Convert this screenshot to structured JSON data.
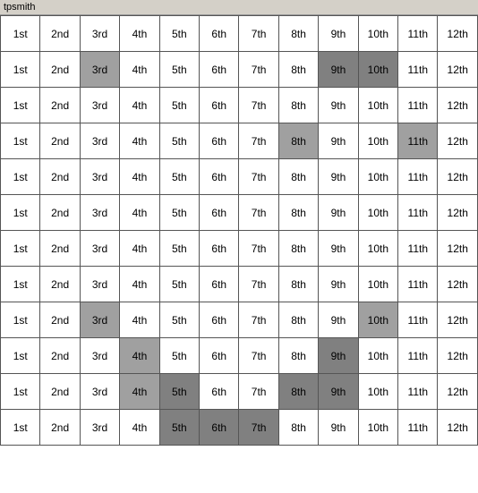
{
  "title": "tpsmith",
  "cols": [
    "1st",
    "2nd",
    "3rd",
    "4th",
    "5th",
    "6th",
    "7th",
    "8th",
    "9th",
    "10th",
    "11th",
    "12th"
  ],
  "rows": [
    [
      false,
      false,
      false,
      false,
      false,
      false,
      false,
      false,
      false,
      false,
      false,
      false
    ],
    [
      false,
      false,
      "gray",
      false,
      false,
      false,
      false,
      false,
      "dark",
      "dark",
      false,
      false
    ],
    [
      false,
      false,
      false,
      false,
      false,
      false,
      false,
      false,
      false,
      false,
      false,
      false
    ],
    [
      false,
      false,
      false,
      false,
      false,
      false,
      false,
      "gray",
      false,
      false,
      "gray",
      false
    ],
    [
      false,
      false,
      false,
      false,
      false,
      false,
      false,
      false,
      false,
      false,
      false,
      false
    ],
    [
      false,
      false,
      false,
      false,
      false,
      false,
      false,
      false,
      false,
      false,
      false,
      false
    ],
    [
      false,
      false,
      false,
      false,
      false,
      false,
      false,
      false,
      false,
      false,
      false,
      false
    ],
    [
      false,
      false,
      false,
      false,
      false,
      false,
      false,
      false,
      false,
      false,
      false,
      false
    ],
    [
      false,
      false,
      "gray",
      false,
      false,
      false,
      false,
      false,
      false,
      "gray",
      false,
      false
    ],
    [
      false,
      false,
      false,
      "gray",
      false,
      false,
      false,
      false,
      "dark",
      false,
      false,
      false
    ],
    [
      false,
      false,
      false,
      "gray",
      "dark",
      false,
      false,
      "dark",
      "dark",
      false,
      false,
      false
    ],
    [
      false,
      false,
      false,
      false,
      "dark",
      "dark",
      "dark",
      false,
      false,
      false,
      false,
      false
    ]
  ]
}
